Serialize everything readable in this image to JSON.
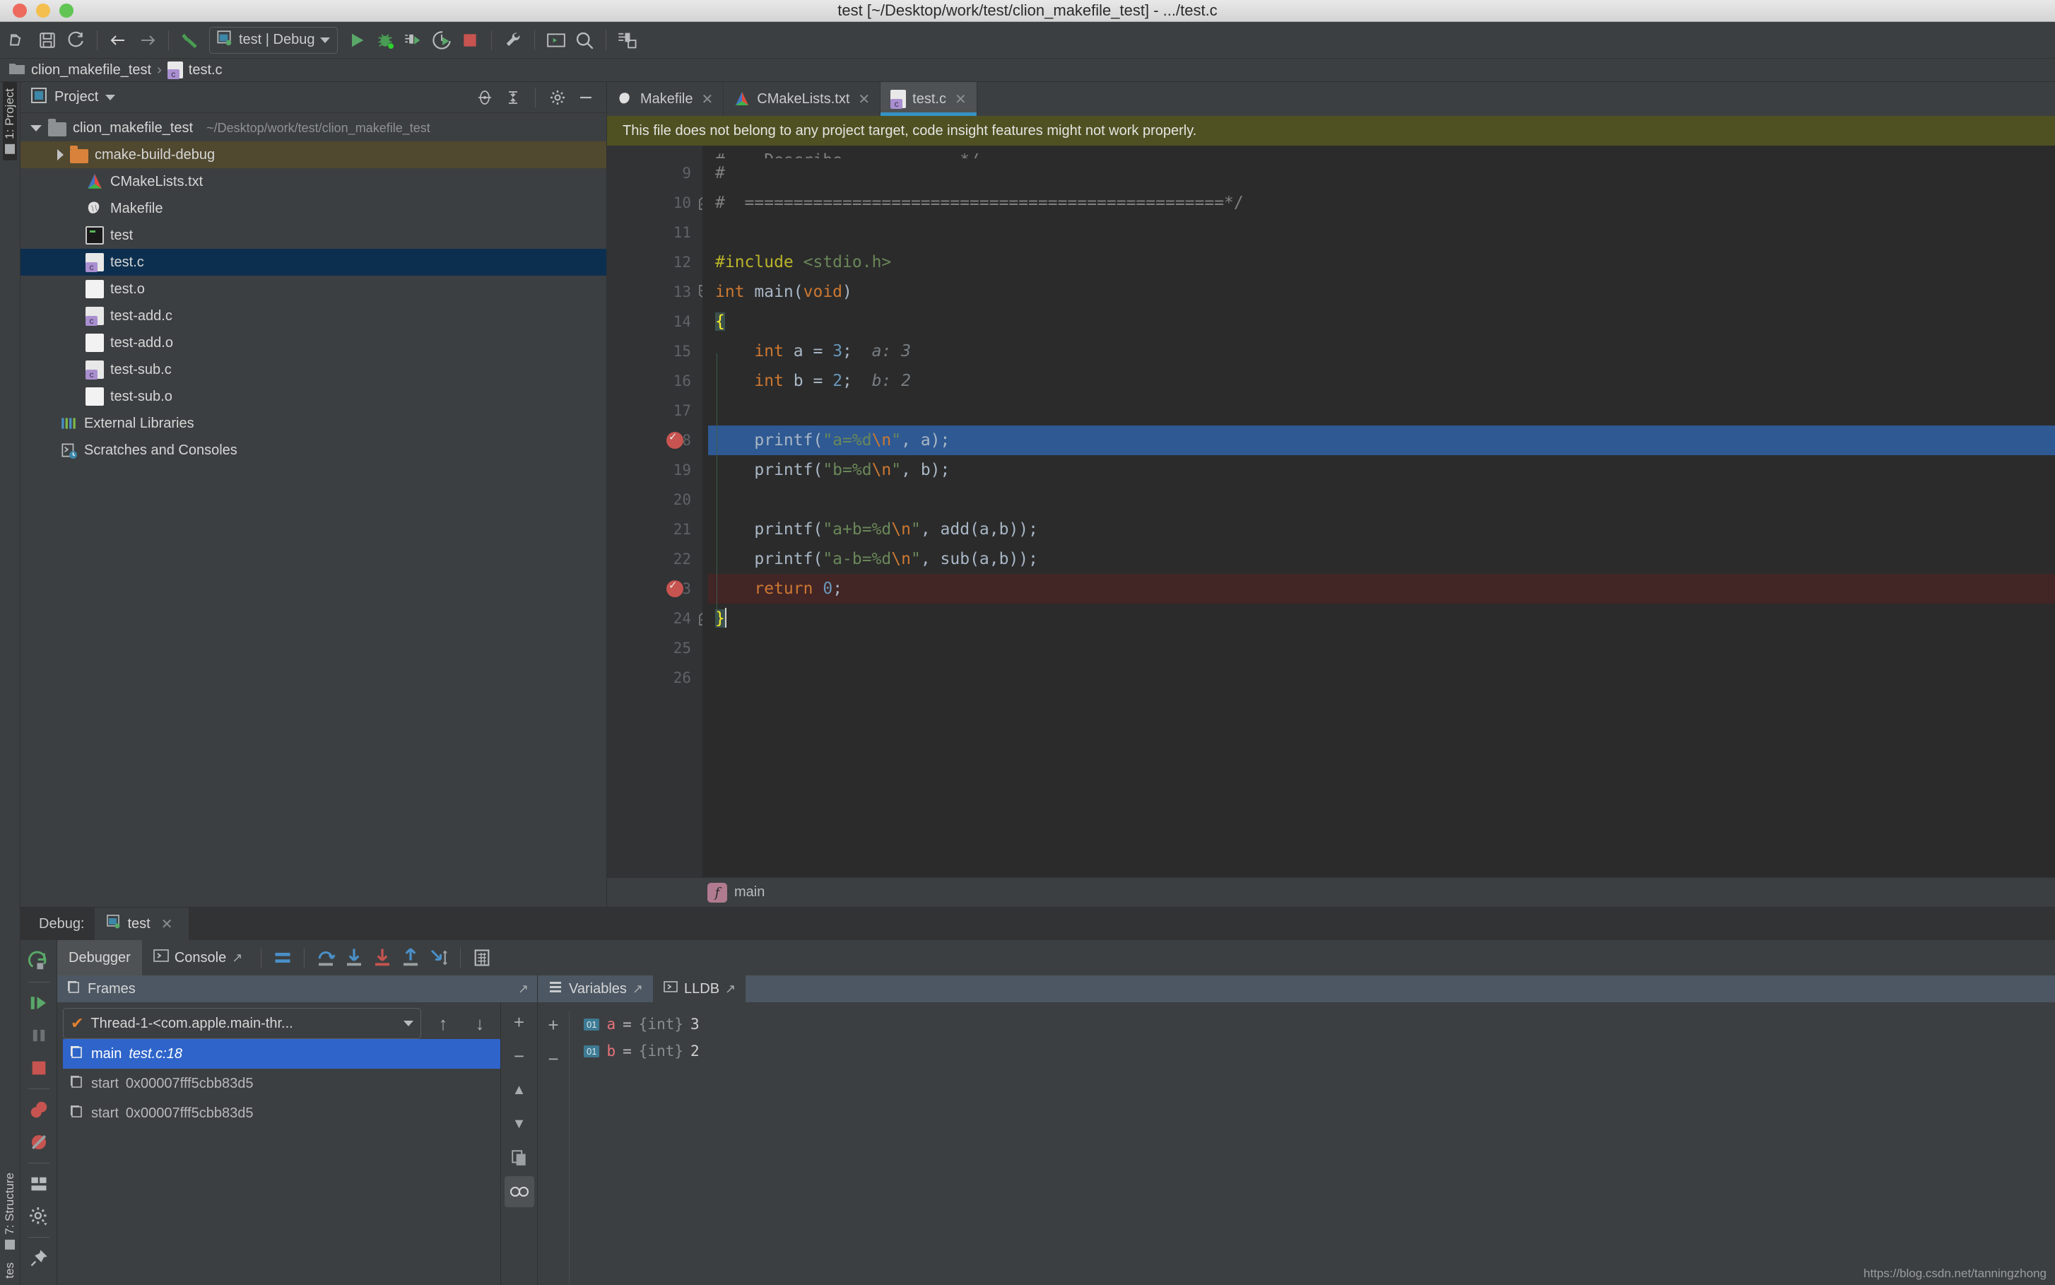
{
  "window": {
    "title": "test [~/Desktop/work/test/clion_makefile_test] - .../test.c",
    "traffic": [
      "close",
      "minimize",
      "zoom"
    ]
  },
  "toolbar": {
    "buttons": [
      {
        "name": "open-folder",
        "icon": "folder-open-icon",
        "tooltip": "Open"
      },
      {
        "name": "save-all",
        "icon": "save-icon",
        "tooltip": "Save All"
      },
      {
        "name": "sync",
        "icon": "refresh-icon",
        "tooltip": "Synchronize"
      },
      {
        "name": "back",
        "icon": "arrow-left-icon",
        "tooltip": "Back"
      },
      {
        "name": "forward",
        "icon": "arrow-right-icon",
        "tooltip": "Forward"
      },
      {
        "name": "build",
        "icon": "hammer-icon",
        "tooltip": "Build"
      }
    ],
    "run_config": {
      "label": "test | Debug",
      "icon": "run-config-icon"
    },
    "run_buttons": [
      {
        "name": "run",
        "icon": "play-icon"
      },
      {
        "name": "debug",
        "icon": "bug-icon"
      },
      {
        "name": "run-with-coverage",
        "icon": "coverage-icon"
      },
      {
        "name": "profile",
        "icon": "profiler-icon"
      },
      {
        "name": "stop",
        "icon": "stop-icon"
      }
    ],
    "right_buttons": [
      {
        "name": "settings",
        "icon": "wrench-icon"
      },
      {
        "name": "terminal",
        "icon": "terminal-icon"
      },
      {
        "name": "search-everywhere",
        "icon": "search-icon"
      },
      {
        "name": "save-layout",
        "icon": "save-layout-icon"
      }
    ]
  },
  "breadcrumb": {
    "project": "clion_makefile_test",
    "separator": "›",
    "file": "test.c"
  },
  "vertical_tabs": {
    "left_top": "1: Project",
    "left_bottom": "7: Structure",
    "left_favorites": "tes"
  },
  "project_pane": {
    "title": "Project",
    "header_icons": [
      "locate-icon",
      "collapse-all-icon",
      "gear-icon",
      "hide-icon"
    ],
    "tree": [
      {
        "label": "clion_makefile_test",
        "path": "~/Desktop/work/test/clion_makefile_test",
        "icon": "folder-icon",
        "state": "expanded",
        "depth": 0
      },
      {
        "label": "cmake-build-debug",
        "path": "",
        "icon": "folder-orange-icon",
        "state": "collapsed",
        "depth": 1,
        "highlight": "build"
      },
      {
        "label": "CMakeLists.txt",
        "path": "",
        "icon": "cmake-icon",
        "depth": 1
      },
      {
        "label": "Makefile",
        "path": "",
        "icon": "gnu-make-icon",
        "depth": 1
      },
      {
        "label": "test",
        "path": "",
        "icon": "executable-icon",
        "depth": 1
      },
      {
        "label": "test.c",
        "path": "",
        "icon": "c-file-icon",
        "depth": 1,
        "highlight": "selected"
      },
      {
        "label": "test.o",
        "path": "",
        "icon": "object-file-icon",
        "depth": 1
      },
      {
        "label": "test-add.c",
        "path": "",
        "icon": "c-file-icon",
        "depth": 1
      },
      {
        "label": "test-add.o",
        "path": "",
        "icon": "object-file-icon",
        "depth": 1
      },
      {
        "label": "test-sub.c",
        "path": "",
        "icon": "c-file-icon",
        "depth": 1
      },
      {
        "label": "test-sub.o",
        "path": "",
        "icon": "object-file-icon",
        "depth": 1
      },
      {
        "label": "External Libraries",
        "path": "",
        "icon": "libraries-icon",
        "depth": 0
      },
      {
        "label": "Scratches and Consoles",
        "path": "",
        "icon": "scratches-icon",
        "depth": 0
      }
    ]
  },
  "editor": {
    "tabs": [
      {
        "label": "Makefile",
        "icon": "gnu-make-icon",
        "active": false
      },
      {
        "label": "CMakeLists.txt",
        "icon": "cmake-icon",
        "active": false
      },
      {
        "label": "test.c",
        "icon": "c-file-icon",
        "active": true
      }
    ],
    "close_glyph": "✕",
    "notification": "This file does not belong to any project target, code insight features might not work properly.",
    "first_visible_line": 8,
    "lines": [
      {
        "n": 9,
        "text": "#"
      },
      {
        "n": 10,
        "text": "#  =================================================*/",
        "fold": true
      },
      {
        "n": 11,
        "text": ""
      },
      {
        "n": 12,
        "text": "#include <stdio.h>"
      },
      {
        "n": 13,
        "text": "int main(void)",
        "fold": true
      },
      {
        "n": 14,
        "text": "{"
      },
      {
        "n": 15,
        "text": "    int a = 3;",
        "hint": "a: 3"
      },
      {
        "n": 16,
        "text": "    int b = 2;",
        "hint": "b: 2"
      },
      {
        "n": 17,
        "text": ""
      },
      {
        "n": 18,
        "text": "    printf(\"a=%d\\n\", a);",
        "breakpoint": true,
        "executing": true
      },
      {
        "n": 19,
        "text": "    printf(\"b=%d\\n\", b);"
      },
      {
        "n": 20,
        "text": ""
      },
      {
        "n": 21,
        "text": "    printf(\"a+b=%d\\n\", add(a,b));"
      },
      {
        "n": 22,
        "text": "    printf(\"a-b=%d\\n\", sub(a,b));"
      },
      {
        "n": 23,
        "text": "    return 0;",
        "breakpoint": true,
        "bp_highlight": true
      },
      {
        "n": 24,
        "text": "}",
        "fold": true
      },
      {
        "n": 25,
        "text": ""
      },
      {
        "n": 26,
        "text": ""
      }
    ],
    "footer_breadcrumb": {
      "badge": "f",
      "label": "main"
    }
  },
  "debug": {
    "header_label": "Debug:",
    "session_tab": "test",
    "close_glyph": "✕",
    "tabs": [
      {
        "label": "Debugger",
        "active": true,
        "icon": "debugger-icon"
      },
      {
        "label": "Console",
        "active": false,
        "icon": "console-icon"
      }
    ],
    "toolbar_icons": [
      {
        "name": "layout",
        "icon": "layout-icon"
      },
      {
        "name": "step-over",
        "icon": "step-over-icon"
      },
      {
        "name": "step-into",
        "icon": "step-into-icon"
      },
      {
        "name": "force-step-into",
        "icon": "force-step-into-icon"
      },
      {
        "name": "step-out",
        "icon": "step-out-icon"
      },
      {
        "name": "run-to-cursor",
        "icon": "run-to-cursor-icon"
      },
      {
        "name": "evaluate",
        "icon": "evaluate-expression-icon"
      }
    ],
    "left_rail": [
      {
        "name": "rerun",
        "icon": "rerun-icon"
      },
      {
        "name": "resume",
        "icon": "resume-program-icon"
      },
      {
        "name": "pause",
        "icon": "pause-icon"
      },
      {
        "name": "stop",
        "icon": "stop-icon"
      },
      {
        "name": "view-breakpoints",
        "icon": "view-breakpoints-icon"
      },
      {
        "name": "mute-breakpoints",
        "icon": "mute-breakpoints-icon"
      },
      {
        "name": "restore-layout",
        "icon": "restore-layout-icon"
      },
      {
        "name": "settings",
        "icon": "gear-icon"
      },
      {
        "name": "pin-tab",
        "icon": "pin-icon"
      }
    ],
    "frames": {
      "title": "Frames",
      "thread": "Thread-1-<com.apple.main-thr...",
      "thread_status_icon": "check-icon",
      "nav_up": "↑",
      "nav_down": "↓",
      "items": [
        {
          "name": "main",
          "location": "test.c:18",
          "selected": true
        },
        {
          "name": "start",
          "location": "0x00007fff5cbb83d5",
          "selected": false
        },
        {
          "name": "start",
          "location": "0x00007fff5cbb83d5",
          "selected": false
        }
      ],
      "rail_buttons": [
        {
          "name": "add",
          "glyph": "+"
        },
        {
          "name": "remove",
          "glyph": "−"
        },
        {
          "name": "move-up",
          "glyph": "▲"
        },
        {
          "name": "move-down",
          "glyph": "▼"
        },
        {
          "name": "copy",
          "glyph": "copy-icon"
        },
        {
          "name": "watches-toggle",
          "glyph": "watches-icon"
        }
      ]
    },
    "variables": {
      "title": "Variables",
      "secondary_tab": "LLDB",
      "rows": [
        {
          "badge": "01",
          "name": "a",
          "eq": "=",
          "type": "{int}",
          "value": "3"
        },
        {
          "badge": "01",
          "name": "b",
          "eq": "=",
          "type": "{int}",
          "value": "2"
        }
      ]
    }
  },
  "watermark": "https://blog.csdn.net/tanningzhong",
  "colors": {
    "accent_blue": "#3592c4",
    "selection_blue": "#2f65ca",
    "exec_line": "#2f5992",
    "bp_line": "#422525",
    "notif_bg": "#4f5123",
    "panel_bg": "#3c3f41",
    "editor_bg": "#2b2b2b",
    "gutter_bg": "#313335",
    "keyword": "#cc7832",
    "string": "#6a8759",
    "number": "#6897bb"
  }
}
